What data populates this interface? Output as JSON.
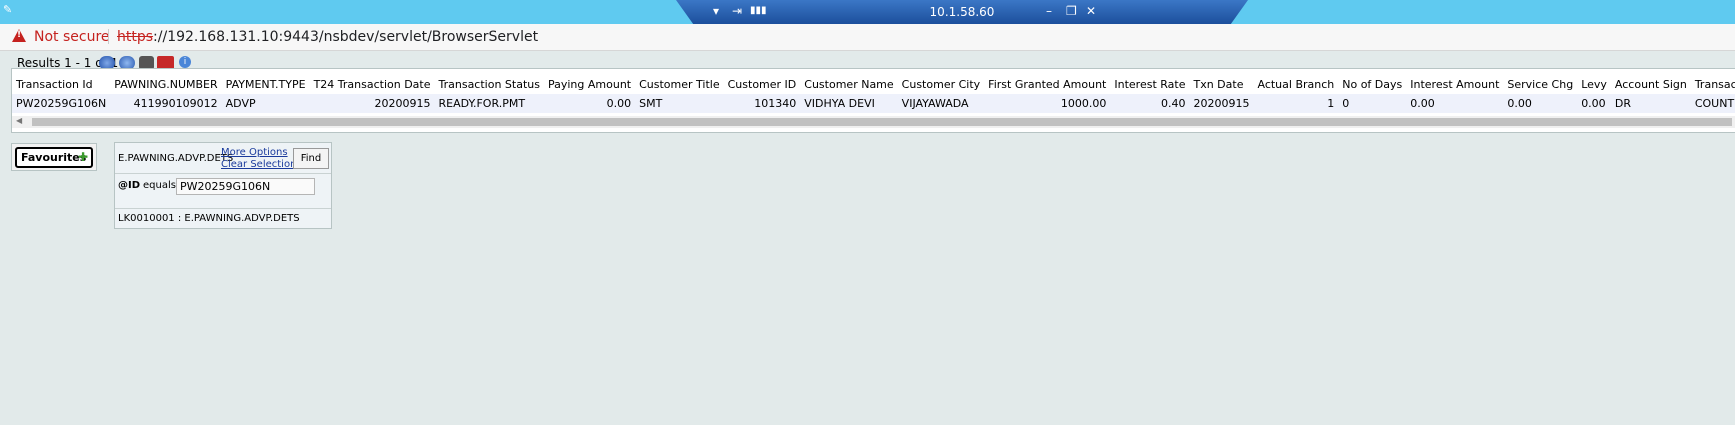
{
  "remote_bar": {
    "host_ip": "10.1.58.60"
  },
  "address_bar": {
    "security_label": "Not secure",
    "url_scheme": "https",
    "url_rest": "://192.168.131.10:9443/nsbdev/servlet/BrowserServlet"
  },
  "results": {
    "text": "Results 1 - 1 of 1"
  },
  "table": {
    "columns": [
      "Transaction Id",
      "PAWNING.NUMBER",
      "PAYMENT.TYPE",
      "T24 Transaction Date",
      "Transaction Status",
      "Paying Amount",
      "Customer Title",
      "Customer ID",
      "Customer Name",
      "Customer City",
      "First Granted Amount",
      "Interest Rate",
      "Txn Date",
      "Actual Branch",
      "No of Days",
      "Interest Amount",
      "Service Chg",
      "Levy",
      "Account Sign",
      "Transaction Channel"
    ],
    "rows": [
      [
        "PW20259G106N",
        "411990109012",
        "ADVP",
        "20200915",
        "READY.FOR.PMT",
        "0.00",
        "SMT",
        "101340",
        "VIDHYA DEVI",
        "VIJAYAWADA",
        "1000.00",
        "0.40",
        "20200915",
        "1",
        "0",
        "0.00",
        "0.00",
        "0.00",
        "DR",
        "COUNT"
      ]
    ]
  },
  "favourites": {
    "label": "Favourites"
  },
  "selection": {
    "application": "E.PAWNING.ADVP.DETS",
    "more_options": "More Options",
    "clear_selection": "Clear Selection",
    "find_label": "Find",
    "field": "@ID",
    "operator": "equals",
    "value": "PW20259G106N",
    "footer": "LK0010001 : E.PAWNING.ADVP.DETS"
  },
  "icons": [
    "pin-icon",
    "signal-icon",
    "minimize-icon",
    "restore-icon",
    "close-icon",
    "warning-icon",
    "refresh-icon",
    "export-icon",
    "next-icon",
    "toolbox-icon",
    "info-icon",
    "add-favourite-icon"
  ]
}
